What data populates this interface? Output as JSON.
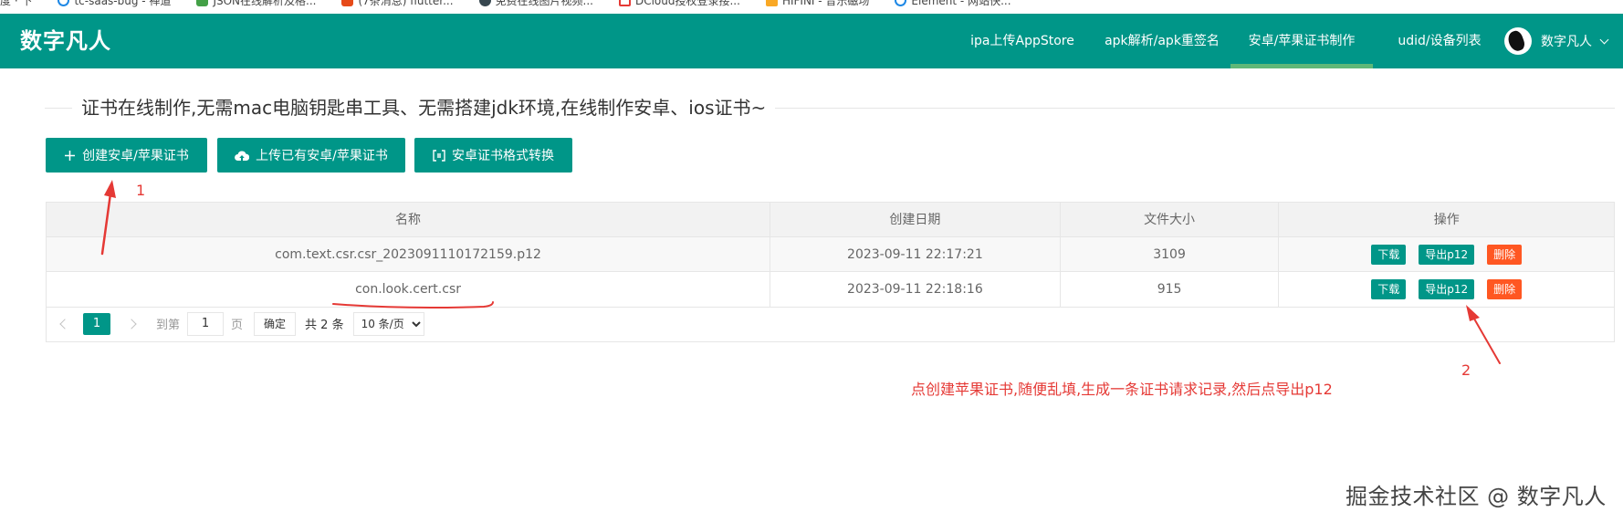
{
  "browser": {
    "bookmarks": [
      {
        "label": "度 · 下",
        "color": "#999999",
        "icon": "bookmark-icon"
      },
      {
        "label": "tc-saas-bug - 禅道",
        "color": "#1e88e5",
        "icon": "zentao-icon"
      },
      {
        "label": "JSON在线解析及格...",
        "color": "#43a047",
        "icon": "json-icon"
      },
      {
        "label": "(7条消息) flutter...",
        "color": "#e64a19",
        "icon": "csdn-icon"
      },
      {
        "label": "免费在线图片视频...",
        "color": "#37474f",
        "icon": "tool-icon"
      },
      {
        "label": "DCloud授权登录接...",
        "color": "#e53935",
        "icon": "dcloud-icon"
      },
      {
        "label": "HIFINI - 音乐磁场",
        "color": "#f9a825",
        "icon": "music-icon"
      },
      {
        "label": "Element - 网站快...",
        "color": "#1e88e5",
        "icon": "element-icon"
      }
    ]
  },
  "header": {
    "logo": "数字凡人",
    "nav": [
      {
        "label": "ipa上传AppStore",
        "active": false
      },
      {
        "label": "apk解析/apk重签名",
        "active": false
      },
      {
        "label": "安卓/苹果证书制作",
        "active": true
      },
      {
        "label": "udid/设备列表",
        "active": false
      }
    ],
    "user_name": "数字凡人",
    "accent_color": "#009688",
    "active_underline_color": "#5FB878"
  },
  "section": {
    "title": "证书在线制作,无需mac电脑钥匙串工具、无需搭建jdk环境,在线制作安卓、ios证书~"
  },
  "toolbar": {
    "buttons": [
      {
        "label": "创建安卓/苹果证书",
        "icon": "plus-icon"
      },
      {
        "label": "上传已有安卓/苹果证书",
        "icon": "cloud-upload-icon"
      },
      {
        "label": "安卓证书格式转换",
        "icon": "convert-icon"
      }
    ]
  },
  "table": {
    "columns": [
      "名称",
      "创建日期",
      "文件大小",
      "操作"
    ],
    "rows": [
      {
        "name": "com.text.csr.csr_2023091110172159.p12",
        "date": "2023-09-11 22:17:21",
        "size": "3109"
      },
      {
        "name": "con.look.cert.csr",
        "date": "2023-09-11 22:18:16",
        "size": "915"
      }
    ],
    "actions": {
      "download": "下载",
      "export": "导出p12",
      "delete": "删除"
    }
  },
  "pager": {
    "current_page": "1",
    "goto_label": "到第",
    "goto_value": "1",
    "page_unit": "页",
    "confirm_label": "确定",
    "total_label": "共 2 条",
    "page_size_option": "10 条/页"
  },
  "annotations": {
    "marker_1": "1",
    "marker_2": "2",
    "note": "点创建苹果证书,随便乱填,生成一条证书请求记录,然后点导出p12",
    "color": "#e53935"
  },
  "watermark": "掘金技术社区 @ 数字凡人"
}
